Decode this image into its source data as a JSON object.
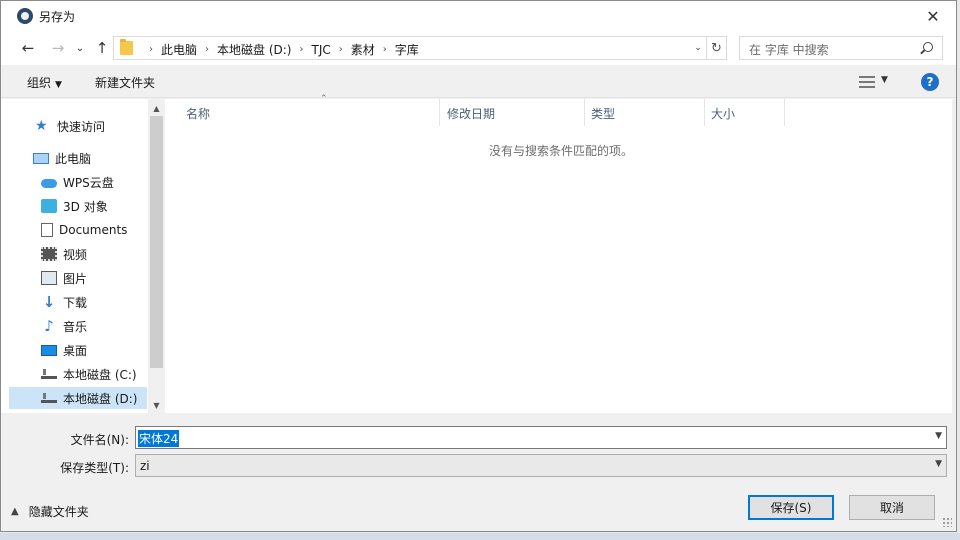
{
  "window": {
    "title": "另存为",
    "close": "✕"
  },
  "nav": {
    "back": "←",
    "forward": "→",
    "recent": "⌄",
    "up": "↑",
    "dropdown": "⌄",
    "refresh": "↻"
  },
  "address": {
    "segments": [
      "此电脑",
      "本地磁盘 (D:)",
      "TJC",
      "素材",
      "字库"
    ],
    "separator": "›"
  },
  "search": {
    "placeholder": "在 字库 中搜索"
  },
  "toolbar": {
    "organize": "组织",
    "new_folder": "新建文件夹",
    "help": "?"
  },
  "sidebar": {
    "items": [
      {
        "label": "快速访问",
        "icon": "star-icon"
      },
      {
        "label": "此电脑",
        "icon": "computer-icon"
      },
      {
        "label": "WPS云盘",
        "icon": "cloud-icon"
      },
      {
        "label": "3D 对象",
        "icon": "cube-icon"
      },
      {
        "label": "Documents",
        "icon": "document-icon"
      },
      {
        "label": "视频",
        "icon": "video-icon"
      },
      {
        "label": "图片",
        "icon": "picture-icon"
      },
      {
        "label": "下载",
        "icon": "download-icon"
      },
      {
        "label": "音乐",
        "icon": "music-icon"
      },
      {
        "label": "桌面",
        "icon": "desktop-icon"
      },
      {
        "label": "本地磁盘 (C:)",
        "icon": "drive-icon"
      },
      {
        "label": "本地磁盘 (D:)",
        "icon": "drive-icon",
        "selected": true
      }
    ]
  },
  "filelist": {
    "columns": [
      "名称",
      "修改日期",
      "类型",
      "大小"
    ],
    "empty_message": "没有与搜索条件匹配的项。"
  },
  "form": {
    "filename_label": "文件名(N):",
    "filename_value": "宋体24",
    "filetype_label": "保存类型(T):",
    "filetype_value": "zi"
  },
  "footer": {
    "hide_folders": "隐藏文件夹",
    "save": "保存(S)",
    "cancel": "取消"
  }
}
